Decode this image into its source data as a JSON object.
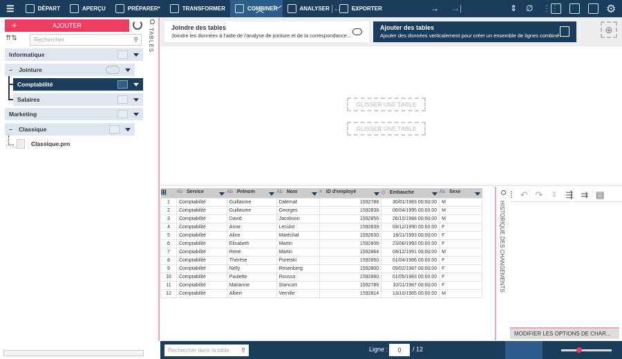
{
  "topbar": {
    "items": [
      {
        "label": "DÉPART",
        "icon": "cube-icon"
      },
      {
        "label": "APERÇU",
        "icon": "eye-icon"
      },
      {
        "label": "PRÉPARER*",
        "icon": "columns-icon"
      },
      {
        "label": "TRANSFORMER",
        "icon": "cycle-icon"
      },
      {
        "label": "COMBINER",
        "icon": "combine-icon",
        "active": true
      },
      {
        "label": "ANALYSER",
        "icon": "clipboard-icon"
      },
      {
        "label": "EXPORTER",
        "icon": "export-icon"
      }
    ],
    "accent": "#1b3d5d"
  },
  "left": {
    "add_label": "AJOUTER",
    "search_placeholder": "Rechercher",
    "tabs_label": "TABLES",
    "tree": [
      {
        "label": "Informatique"
      },
      {
        "label": "Jointure",
        "prefix": "–"
      },
      {
        "label": "Comptabilité",
        "selected": true
      },
      {
        "label": "Salaires"
      },
      {
        "label": "Marketing"
      },
      {
        "label": "Classique",
        "prefix": "–"
      },
      {
        "label": "Classique.prn"
      }
    ]
  },
  "cards": {
    "join": {
      "title": "Joindre des tables",
      "desc": "Joindre les données à l'aide de l'analyse de jointure et de la correspondance..."
    },
    "append": {
      "title": "Ajouter des tables",
      "desc": "Ajouter des données verticalement pour créer un ensemble de lignes combiné"
    }
  },
  "drop": {
    "zone1": "GLISSER UNE TABLE",
    "zone2": "GLISSER UNE TABLE"
  },
  "table": {
    "columns": [
      {
        "type": "Ab",
        "name": "Service"
      },
      {
        "type": "Ab",
        "name": "Prénom"
      },
      {
        "type": "Ab",
        "name": "Nom"
      },
      {
        "type": "#",
        "name": "ID d'employé"
      },
      {
        "type": "◷",
        "name": "Embauche"
      },
      {
        "type": "Ab",
        "name": "Sexe"
      }
    ],
    "rows": [
      [
        "1",
        "Comptabilité",
        "Guillaume",
        "Dalemat",
        "1592788",
        "30/01/1983 00:00:00",
        "M"
      ],
      [
        "2",
        "Comptabilité",
        "Guillaume",
        "Georges",
        "1592838",
        "06/04/1995 00:00:00",
        "M"
      ],
      [
        "3",
        "Comptabilité",
        "David",
        "Jacobson",
        "1592856",
        "26/10/1988 00:00:00",
        "M"
      ],
      [
        "4",
        "Comptabilité",
        "Anne",
        "Leculot",
        "1592839",
        "03/12/1990 00:00:00",
        "F"
      ],
      [
        "5",
        "Comptabilité",
        "Aline",
        "Maréchal",
        "1592830",
        "18/11/1993 00:00:00",
        "F"
      ],
      [
        "6",
        "Comptabilité",
        "Elisabeth",
        "Martin",
        "1592806",
        "23/06/1993 00:00:00",
        "F"
      ],
      [
        "7",
        "Comptabilité",
        "René",
        "Martin",
        "1592864",
        "04/12/1991 00:00:00",
        "M"
      ],
      [
        "8",
        "Comptabilité",
        "Thérèse",
        "Poretski",
        "1592850",
        "01/04/1986 00:00:00",
        "F"
      ],
      [
        "9",
        "Comptabilité",
        "Nelly",
        "Rosenberg",
        "1592800",
        "09/02/1987 00:00:00",
        "F"
      ],
      [
        "10",
        "Comptabilité",
        "Paulette",
        "Rousso",
        "1592880",
        "01/05/1983 00:00:00",
        "F"
      ],
      [
        "11",
        "Comptabilité",
        "Marianne",
        "Stancort",
        "1592789",
        "10/11/1987 00:00:00",
        "F"
      ],
      [
        "12",
        "Comptabilité",
        "Albert",
        "Vernille",
        "1592814",
        "13/10/1985 00:00:00",
        "M"
      ]
    ]
  },
  "history": {
    "label": "HISTORIQUE DES CHANGEMENTS",
    "modify_button": "MODIFIER LES OPTIONS DE CHAR..."
  },
  "bottom": {
    "search_placeholder": "Rechercher dans la table",
    "line_label": "Ligne :",
    "line_value": "0",
    "total": "/ 12",
    "zoom_level": 0.35
  }
}
